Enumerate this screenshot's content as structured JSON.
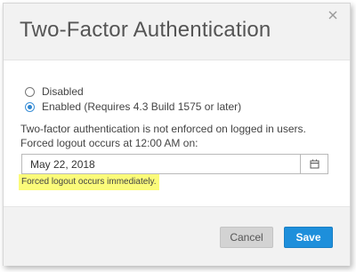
{
  "dialog": {
    "title": "Two-Factor Authentication",
    "close_icon": "close-icon"
  },
  "options": [
    {
      "label": "Disabled",
      "checked": false
    },
    {
      "label": "Enabled (Requires 4.3 Build 1575 or later)",
      "checked": true
    }
  ],
  "description": "Two-factor authentication is not enforced on logged in users. Forced logout occurs at 12:00 AM on:",
  "date_field": {
    "value": "May 22, 2018",
    "icon": "calendar-icon"
  },
  "notice": "Forced logout occurs immediately.",
  "notice_highlight_color": "#fbfb7a",
  "buttons": {
    "cancel": "Cancel",
    "save": "Save"
  },
  "colors": {
    "accent": "#1e8fdb",
    "header_bg": "#f2f2f2"
  }
}
